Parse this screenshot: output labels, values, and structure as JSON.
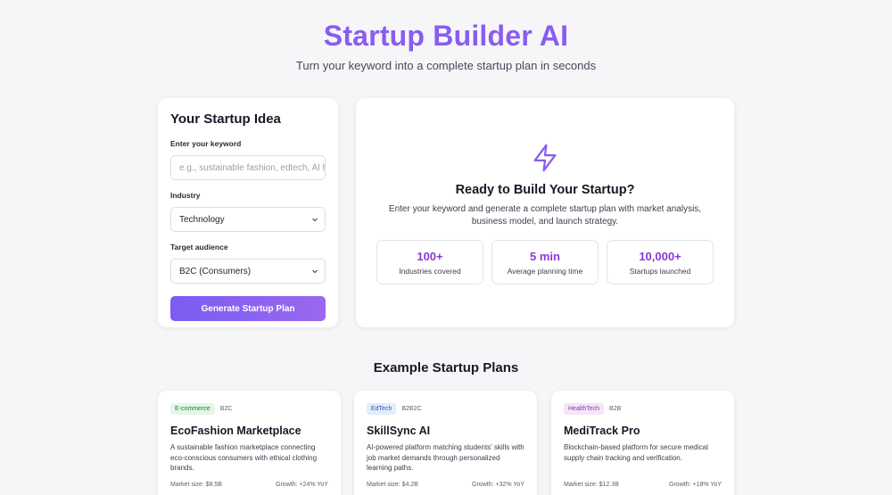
{
  "header": {
    "title": "Startup Builder AI",
    "subtitle": "Turn your keyword into a complete startup plan in seconds"
  },
  "form": {
    "title": "Your Startup Idea",
    "keyword_label": "Enter your keyword",
    "keyword_placeholder": "e.g., sustainable fashion, edtech, AI h",
    "keyword_value": "",
    "industry_label": "Industry",
    "industry_value": "Technology",
    "audience_label": "Target audience",
    "audience_value": "B2C (Consumers)",
    "generate_label": "Generate Startup Plan"
  },
  "ready": {
    "icon": "lightning-bolt-icon",
    "title": "Ready to Build Your Startup?",
    "description": "Enter your keyword and generate a complete startup plan with market analysis, business model, and launch strategy.",
    "stats": [
      {
        "value": "100+",
        "label": "Industries covered"
      },
      {
        "value": "5 min",
        "label": "Average planning time"
      },
      {
        "value": "10,000+",
        "label": "Startups launched"
      }
    ]
  },
  "examples": {
    "title": "Example Startup Plans",
    "plans": [
      {
        "category": "E-commerce",
        "audience": "B2C",
        "name": "EcoFashion Marketplace",
        "description": "A sustainable fashion marketplace connecting eco-conscious consumers with ethical clothing brands.",
        "market_size": "Market size: $8.5B",
        "growth": "Growth: +24% YoY"
      },
      {
        "category": "EdTech",
        "audience": "B2B2C",
        "name": "SkillSync AI",
        "description": "AI-powered platform matching students' skills with job market demands through personalized learning paths.",
        "market_size": "Market size: $4.2B",
        "growth": "Growth: +32% YoY"
      },
      {
        "category": "HealthTech",
        "audience": "B2B",
        "name": "MediTrack Pro",
        "description": "Blockchain-based platform for secure medical supply chain tracking and verification.",
        "market_size": "Market size: $12.3B",
        "growth": "Growth: +18% YoY"
      }
    ]
  },
  "colors": {
    "accent": "#8a5cf0",
    "stat_value": "#8a39d4",
    "tag_ecommerce_bg": "#e4f6e8",
    "tag_ecommerce_fg": "#1e7a3a",
    "tag_edtech_bg": "#e3ecfb",
    "tag_edtech_fg": "#2b5cb3",
    "tag_healthtech_bg": "#f3e6f7",
    "tag_healthtech_fg": "#8a3aa8"
  }
}
